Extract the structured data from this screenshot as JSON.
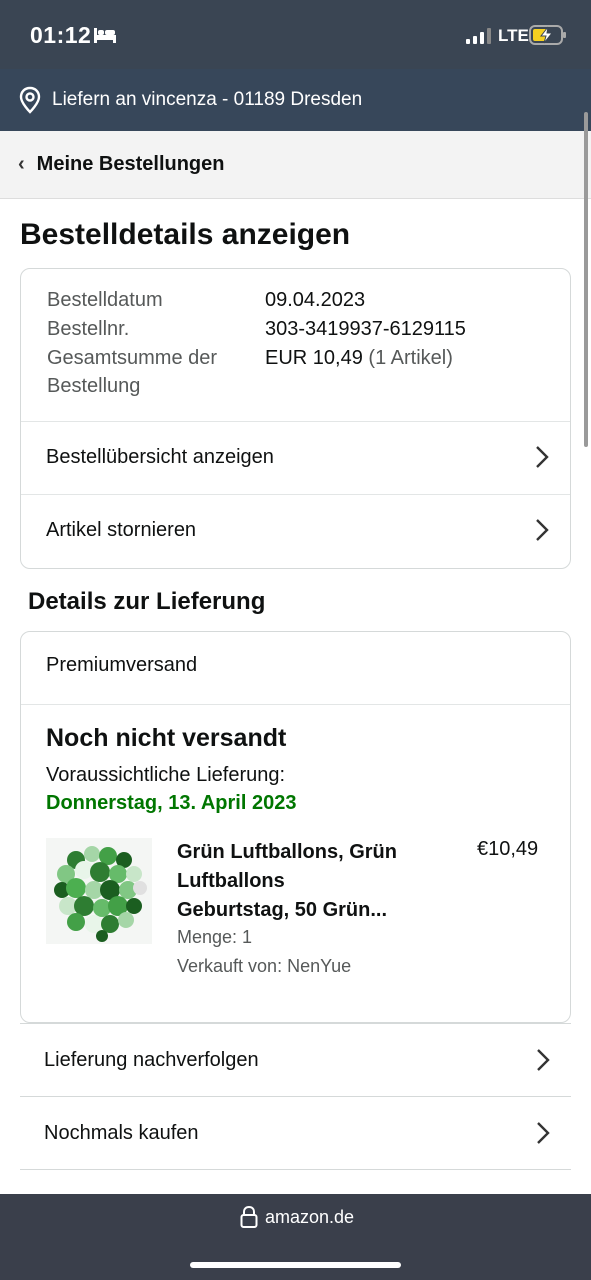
{
  "status_bar": {
    "time": "01:12",
    "network": "LTE"
  },
  "deliver": {
    "text": "Liefern an vincenza - 01189 Dresden"
  },
  "nav": {
    "back_label": "Meine Bestellungen"
  },
  "page_title": "Bestelldetails anzeigen",
  "order_info": {
    "date_label": "Bestelldatum",
    "date_value": "09.04.2023",
    "number_label": "Bestellnr.",
    "number_value": "303-3419937-6129115",
    "total_label_line1": "Gesamtsumme der",
    "total_label_line2": "Bestellung",
    "total_value": "EUR 10,49",
    "total_items": "(1 Artikel)"
  },
  "order_actions": {
    "overview": "Bestellübersicht anzeigen",
    "cancel": "Artikel stornieren"
  },
  "delivery_section_title": "Details zur Lieferung",
  "delivery": {
    "shipping_type": "Premiumversand",
    "status": "Noch nicht versandt",
    "eta_label": "Voraussichtliche Lieferung:",
    "eta_date": "Donnerstag, 13. April 2023",
    "eta_color": "#007600"
  },
  "product": {
    "title_line1": "Grün Luftballons, Grün",
    "title_line2": "Luftballons",
    "title_line3": "Geburtstag, 50 Grün...",
    "price": "€10,49",
    "quantity": "Menge: 1",
    "seller": "Verkauft von: NenYue"
  },
  "list_actions": {
    "track": "Lieferung nachverfolgen",
    "buy_again": "Nochmals kaufen"
  },
  "url_bar": {
    "domain": "amazon.de"
  }
}
